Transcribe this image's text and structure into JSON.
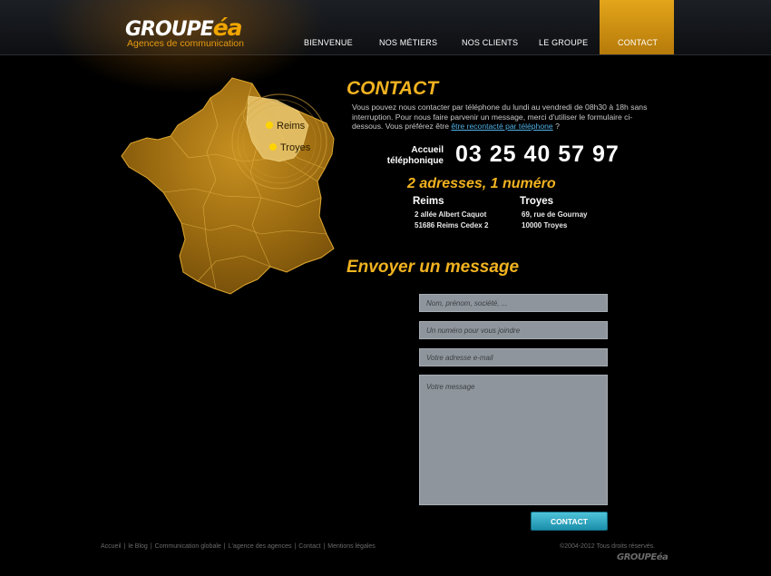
{
  "header": {
    "logo_main": "GROUPE",
    "logo_accent": "éa",
    "logo_tagline": "Agences de communication",
    "nav": [
      "BIENVENUE",
      "NOS MÉTIERS",
      "NOS CLIENTS",
      "LE GROUPE",
      "CONTACT"
    ],
    "active_nav": "CONTACT"
  },
  "map": {
    "city_reims": "Reims",
    "city_troyes": "Troyes"
  },
  "contact": {
    "title": "CONTACT",
    "intro_text": "Vous pouvez nous contacter par téléphone du lundi au vendredi de 08h30 à 18h sans interruption. Pour nous faire parvenir un message, merci d'utiliser le formulaire ci-dessous. Vous préférez être ",
    "intro_link": "être recontacté par téléphone",
    "intro_end": " ?",
    "phone_label_1": "Accueil",
    "phone_label_2": "téléphonique",
    "phone_number": "03 25 40 57 97",
    "addresses_title": "2 adresses, 1 numéro",
    "reims": {
      "name": "Reims",
      "line1": "2 allée Albert Caquot",
      "line2": "51686 Reims Cedex 2"
    },
    "troyes": {
      "name": "Troyes",
      "line1": "69, rue de Gournay",
      "line2": "10000 Troyes"
    }
  },
  "form": {
    "title": "Envoyer un message",
    "name_placeholder": "Nom, prénom, société, ...",
    "phone_placeholder": "Un numéro pour vous joindre",
    "email_placeholder": "Votre adresse e-mail",
    "message_placeholder": "Votre message",
    "submit_label": "CONTACT"
  },
  "footer": {
    "links": [
      "Accueil",
      "le Blog",
      "Communication globale",
      "L'agence des agences",
      "Contact",
      "Mentions légales"
    ],
    "copyright": "©2004-2012 Tous droits réservés.",
    "logo_main": "GROUPE",
    "logo_accent": "éa"
  },
  "colors": {
    "accent": "#f2b320",
    "nav_active": "#d4960f",
    "button": "#2aa7c2",
    "field": "#8f959c"
  }
}
